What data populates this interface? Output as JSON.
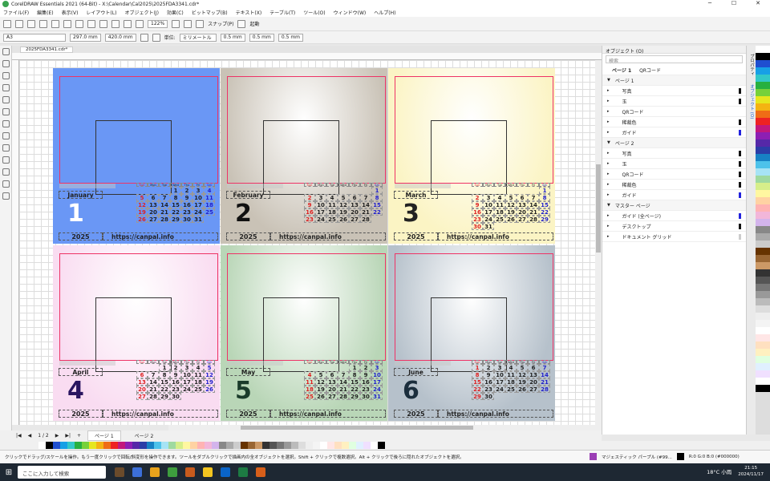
{
  "window": {
    "title": "CorelDRAW Essentials 2021 (64-Bit) - X:\\Calendar\\Cal2025\\2025FDA3341.cdr*",
    "controls": [
      "─",
      "☐",
      "✕"
    ]
  },
  "menu": [
    "ファイル(F)",
    "編集(E)",
    "表示(V)",
    "レイアウト(L)",
    "オブジェクト(J)",
    "効果(C)",
    "ビットマップ(B)",
    "テキスト(X)",
    "テーブル(T)",
    "ツール(O)",
    "ウィンドウ(W)",
    "ヘルプ(H)"
  ],
  "toolbar": {
    "zoom": "122%",
    "snap": "スナップ(P)",
    "launch": "起動",
    "units": "単位:",
    "unit_value": "ミリメートル",
    "nudge": "0.5 mm",
    "dup_x": "0.5 mm",
    "dup_y": "0.5 mm"
  },
  "propertybar": {
    "page_size": "A3",
    "width": "297.0 mm",
    "height": "420.0 mm"
  },
  "document_tab": "2025FDA3341.cdr*",
  "pages_bar": {
    "counter": "1 / 2",
    "tabs": [
      "ページ 1",
      "ページ 2"
    ]
  },
  "calendar": {
    "year": "2025",
    "url": "https://canpal.info",
    "weekday_labels": [
      "Sun",
      "Mon",
      "Tue",
      "Wed",
      "Thu",
      "Fri",
      "Sat"
    ],
    "months": [
      {
        "name": "January",
        "num": "1",
        "first": 3,
        "days": 31,
        "bg": "#6a97f5",
        "numcolor": "#ffffff"
      },
      {
        "name": "February",
        "num": "2",
        "first": 6,
        "days": 28,
        "bg": "#c9c2b6",
        "numcolor": "#111111"
      },
      {
        "name": "March",
        "num": "3",
        "first": 6,
        "days": 31,
        "bg": "#fbf4c4",
        "numcolor": "#222222"
      },
      {
        "name": "April",
        "num": "4",
        "first": 2,
        "days": 30,
        "bg": "#f9dcf1",
        "numcolor": "#2a1560"
      },
      {
        "name": "May",
        "num": "5",
        "first": 4,
        "days": 31,
        "bg": "#b9d6b7",
        "numcolor": "#1a3b2a"
      },
      {
        "name": "June",
        "num": "6",
        "first": 0,
        "days": 30,
        "bg": "#b6c1cb",
        "numcolor": "#1b2e3d"
      }
    ]
  },
  "objects_panel": {
    "header": "オブジェクト (O)",
    "search": "検索",
    "page_title": "ページ 1",
    "qr_label": "QRコード",
    "rows": [
      {
        "text": "ページ 1",
        "level": 0,
        "bar": ""
      },
      {
        "text": "写真",
        "level": 1,
        "bar": "#111111"
      },
      {
        "text": "玉",
        "level": 1,
        "bar": "#111111"
      },
      {
        "text": "QRコード",
        "level": 1,
        "bar": ""
      },
      {
        "text": "稀裁色",
        "level": 1,
        "bar": "#111111"
      },
      {
        "text": "ガイド",
        "level": 1,
        "bar": "#2222dd"
      },
      {
        "text": "ページ 2",
        "level": 0,
        "bar": ""
      },
      {
        "text": "写真",
        "level": 1,
        "bar": "#111111"
      },
      {
        "text": "玉",
        "level": 1,
        "bar": "#111111"
      },
      {
        "text": "QRコード",
        "level": 1,
        "bar": "#111111"
      },
      {
        "text": "稀裁色",
        "level": 1,
        "bar": "#111111"
      },
      {
        "text": "ガイド",
        "level": 1,
        "bar": "#2222dd"
      },
      {
        "text": "マスター ページ",
        "level": 0,
        "bar": ""
      },
      {
        "text": "ガイド (全ページ)",
        "level": 1,
        "bar": "#2222dd"
      },
      {
        "text": "デスクトップ",
        "level": 1,
        "bar": "#111111"
      },
      {
        "text": "ドキュメント グリッド",
        "level": 1,
        "bar": "#cccccc"
      }
    ],
    "side_tabs": [
      "プロパティ",
      "オブジェクト (O)"
    ]
  },
  "status": {
    "hint": "クリックでドラッグ/スケールを操作。もう一度クリックで回転/斜変形を操作できます。ツールをダブルクリックで描画内の全オブジェクトを選択。Shift + クリックで複数選択。Alt + クリックで後ろに隠れたオブジェクトを選択。",
    "fill_name": "マジェスティック パープル (#99...",
    "fill_color": "#9b3fb5",
    "outline": "R:0 G:0 B:0 (#000000)"
  },
  "taskbar": {
    "search": "ここに入力して検索",
    "weather": "18°C 小雨",
    "time": "21:15",
    "date": "2024/11/17"
  },
  "palette_colors": [
    "#ffffff",
    "#000000",
    "#1f4fd0",
    "#17a0e6",
    "#32c8c8",
    "#27b040",
    "#76d13a",
    "#e6e61e",
    "#f4b312",
    "#ef6d16",
    "#e22",
    "#c2187c",
    "#8d1fb3",
    "#5528a8",
    "#2b3da7",
    "#1781c4",
    "#4dc2ea",
    "#a6e3f5",
    "#9fd9a0",
    "#d6ee8a",
    "#fff7a0",
    "#ffd2a3",
    "#ffb3b3",
    "#f2b6d9",
    "#d3b4ec",
    "#888888",
    "#aaaaaa",
    "#cccccc",
    "#663300",
    "#996633",
    "#cc9966",
    "#333333",
    "#555555",
    "#777777",
    "#999999",
    "#bbbbbb",
    "#dddddd",
    "#eeeeee",
    "#f4f4f4",
    "#ffffff",
    "#ffe6e6",
    "#ffe0c0",
    "#fff0c0",
    "#e0ffe0",
    "#e0f0ff",
    "#f0e0ff",
    "#ffffff",
    "#000000"
  ]
}
